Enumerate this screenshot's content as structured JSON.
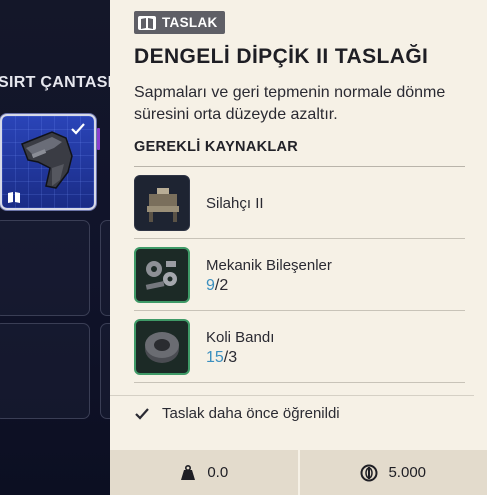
{
  "backpack": {
    "title": "SIRT ÇANTASI"
  },
  "blueprint": {
    "tag": "TASLAK",
    "title": "DENGELİ DİPÇİK II TASLAĞI",
    "description": "Sapmaları ve geri tepmenin normale dönme süresini orta düzeyde azaltır."
  },
  "resources": {
    "header": "GEREKLİ KAYNAKLAR",
    "items": [
      {
        "name": "Silahçı II",
        "have": "",
        "sep": "",
        "need": "",
        "icon": "workbench-icon"
      },
      {
        "name": "Mekanik Bileşenler",
        "have": "9",
        "sep": "/",
        "need": "2",
        "icon": "mechanical-parts-icon"
      },
      {
        "name": "Koli Bandı",
        "have": "15",
        "sep": "/",
        "need": "3",
        "icon": "duct-tape-icon"
      }
    ]
  },
  "status": {
    "learned_text": "Taslak daha önce öğrenildi"
  },
  "footer": {
    "weight": "0.0",
    "price": "5.000"
  },
  "colors": {
    "selected_slot": "#1c2f8a",
    "have_quantity": "#3b8fbf",
    "panel_bg": "#f6f1e6"
  }
}
